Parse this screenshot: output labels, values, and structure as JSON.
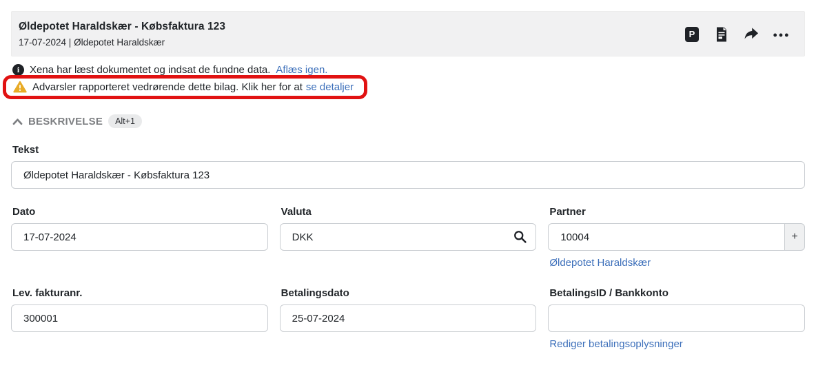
{
  "header": {
    "title": "Øldepotet Haraldskær - Købsfaktura 123",
    "subtitle": "17-07-2024 | Øldepotet Haraldskær",
    "p_icon_label": "P"
  },
  "messages": {
    "info_text": "Xena har læst dokumentet og indsat de fundne data.",
    "info_link": "Aflæs igen.",
    "warning_text": "Advarsler rapporteret vedrørende dette bilag. Klik her for at",
    "warning_link": "se detaljer"
  },
  "section": {
    "title": "BESKRIVELSE",
    "shortcut": "Alt+1"
  },
  "form": {
    "tekst": {
      "label": "Tekst",
      "value": "Øldepotet Haraldskær - Købsfaktura 123"
    },
    "dato": {
      "label": "Dato",
      "value": "17-07-2024"
    },
    "valuta": {
      "label": "Valuta",
      "value": "DKK"
    },
    "partner": {
      "label": "Partner",
      "value": "10004",
      "add_button": "+",
      "link": "Øldepotet Haraldskær"
    },
    "lev_fakturanr": {
      "label": "Lev. fakturanr.",
      "value": "300001"
    },
    "betalingsdato": {
      "label": "Betalingsdato",
      "value": "25-07-2024"
    },
    "betalings_id": {
      "label": "BetalingsID / Bankkonto",
      "value": "",
      "link": "Rediger betalingsoplysninger"
    }
  },
  "colors": {
    "link": "#3c6fba",
    "annotation_red": "#e11212",
    "warning_gold": "#e8ab27",
    "header_bg": "#f1f1f2",
    "icon_dark": "#1f2227"
  }
}
